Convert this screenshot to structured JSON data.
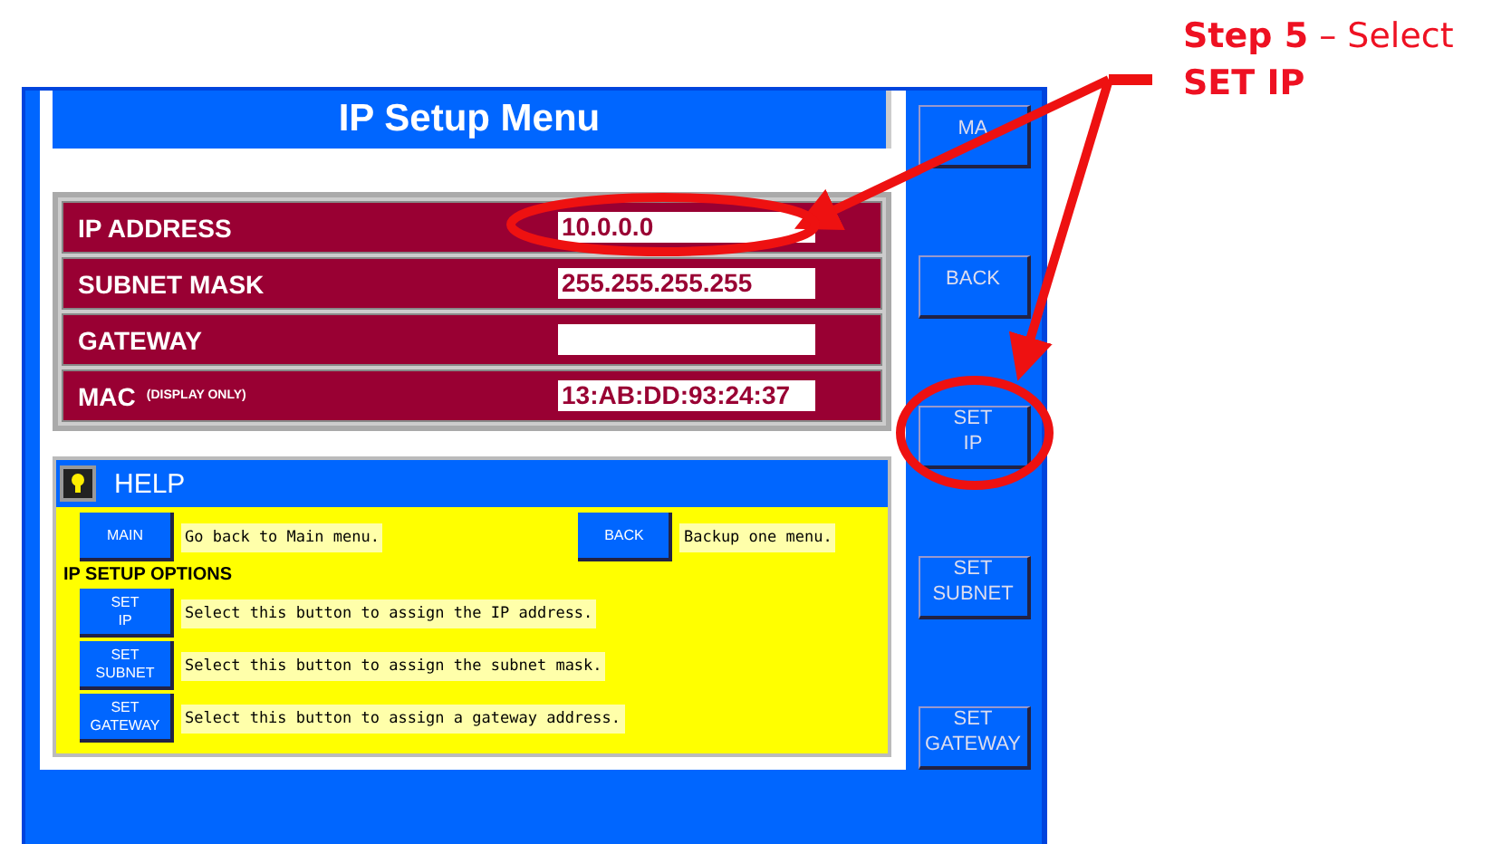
{
  "annotation": {
    "text": "**Step 5** – Select **SET IP**"
  },
  "screen": {
    "title": "IP Setup Menu",
    "fields": [
      {
        "label": "IP ADDRESS",
        "value": "10.0.0.0"
      },
      {
        "label": "SUBNET MASK",
        "value": "255.255.255.255"
      },
      {
        "label": "GATEWAY"
      },
      {
        "label": "MAC",
        "note": "(DISPLAY ONLY)",
        "value": "13:AB:DD:93:24:37"
      }
    ],
    "help": {
      "title": "HELP",
      "nav": [
        {
          "button": "MAIN",
          "text": "Go back to Main menu."
        },
        {
          "button": "BACK",
          "text": "Backup one menu."
        }
      ],
      "options_heading": "IP SETUP OPTIONS",
      "options": [
        {
          "button": "SET\nIP",
          "text": "Select this button to assign the IP address."
        },
        {
          "button": "SET\nSUBNET",
          "text": "Select this button to assign the subnet mask."
        },
        {
          "button": "SET\nGATEWAY",
          "text": "Select this button to assign a gateway address."
        }
      ]
    },
    "side_buttons": [
      {
        "label": "MA"
      },
      {
        "label": "BACK"
      },
      {
        "label": "SET\nIP"
      },
      {
        "label": "SET\nSUBNET"
      },
      {
        "label": "SET\nGATEWAY"
      }
    ]
  }
}
